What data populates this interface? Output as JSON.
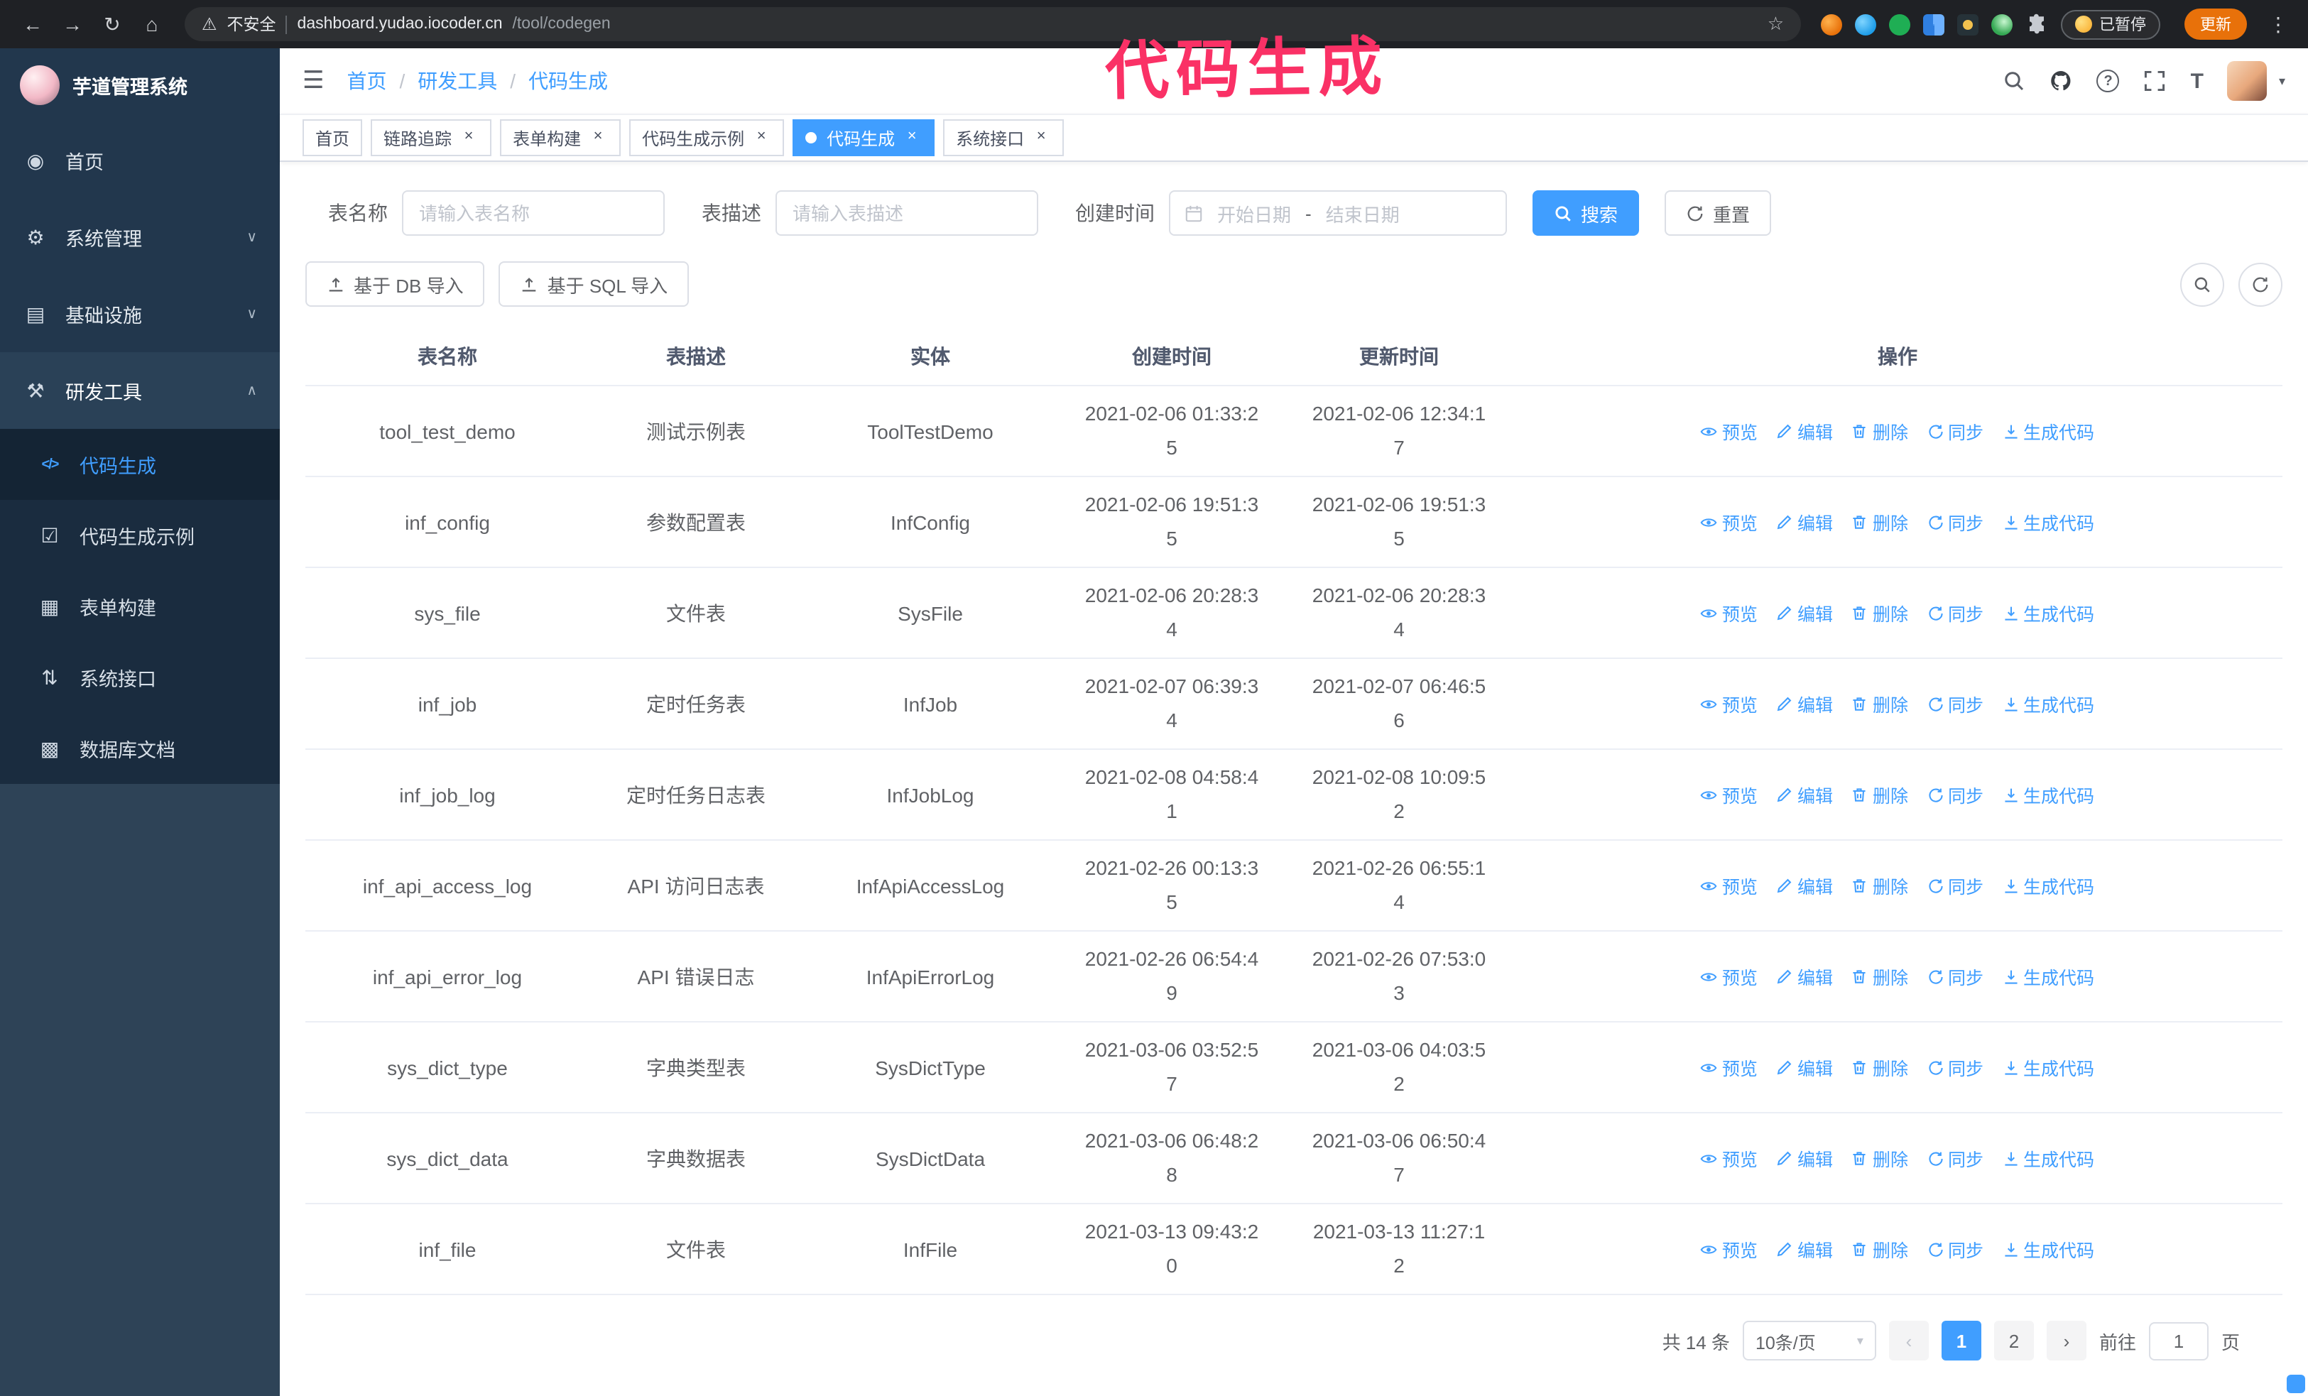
{
  "annotation": {
    "text": "代码生成"
  },
  "browser": {
    "security_warning": "不安全",
    "url_host": "dashboard.yudao.iocoder.cn",
    "url_path": "/tool/codegen",
    "paused_badge": "已暂停",
    "update_label": "更新"
  },
  "icons": {
    "back": "←",
    "forward": "→",
    "reload": "↻",
    "home": "⌂",
    "warning": "⚠",
    "star": "☆",
    "kebab": "⋮",
    "hamburger": "☰",
    "chevron_down": "∨",
    "chevron_up": "∧",
    "caret_down": "▾",
    "close": "×",
    "question": "?",
    "font_size": "T",
    "prev": "‹",
    "next": "›",
    "sidebar_home": "◉",
    "sidebar_system": "⚙",
    "sidebar_infra": "▤",
    "sidebar_tools": "⚒",
    "sub_codegen": "</>",
    "sub_example": "☑",
    "sub_form": "▦",
    "sub_api": "⇅",
    "sub_db": "▩"
  },
  "sidebar": {
    "logo_title": "芋道管理系统",
    "items": [
      {
        "label": "首页"
      },
      {
        "label": "系统管理"
      },
      {
        "label": "基础设施"
      },
      {
        "label": "研发工具"
      }
    ],
    "subitems": [
      {
        "label": "代码生成"
      },
      {
        "label": "代码生成示例"
      },
      {
        "label": "表单构建"
      },
      {
        "label": "系统接口"
      },
      {
        "label": "数据库文档"
      }
    ]
  },
  "navbar": {
    "breadcrumb": [
      "首页",
      "研发工具",
      "代码生成"
    ]
  },
  "tabs": [
    {
      "label": "首页"
    },
    {
      "label": "链路追踪"
    },
    {
      "label": "表单构建"
    },
    {
      "label": "代码生成示例"
    },
    {
      "label": "代码生成"
    },
    {
      "label": "系统接口"
    }
  ],
  "filters": {
    "name_label": "表名称",
    "name_placeholder": "请输入表名称",
    "desc_label": "表描述",
    "desc_placeholder": "请输入表描述",
    "time_label": "创建时间",
    "start_placeholder": "开始日期",
    "range_separator": "-",
    "end_placeholder": "结束日期",
    "search_label": "搜索",
    "reset_label": "重置"
  },
  "toolbar": {
    "import_db_label": "基于 DB 导入",
    "import_sql_label": "基于 SQL 导入"
  },
  "table": {
    "columns": [
      "表名称",
      "表描述",
      "实体",
      "创建时间",
      "更新时间",
      "操作"
    ],
    "ops": [
      {
        "name": "preview-link",
        "icon": "eye",
        "label": "预览"
      },
      {
        "name": "edit-link",
        "icon": "edit",
        "label": "编辑"
      },
      {
        "name": "delete-link",
        "icon": "delete",
        "label": "删除"
      },
      {
        "name": "sync-link",
        "icon": "sync",
        "label": "同步"
      },
      {
        "name": "generate-code-link",
        "icon": "download",
        "label": "生成代码"
      }
    ],
    "rows": [
      {
        "name": "tool_test_demo",
        "desc": "测试示例表",
        "entity": "ToolTestDemo",
        "created": "2021-02-06 01:33:25",
        "updated": "2021-02-06 12:34:17"
      },
      {
        "name": "inf_config",
        "desc": "参数配置表",
        "entity": "InfConfig",
        "created": "2021-02-06 19:51:35",
        "updated": "2021-02-06 19:51:35"
      },
      {
        "name": "sys_file",
        "desc": "文件表",
        "entity": "SysFile",
        "created": "2021-02-06 20:28:34",
        "updated": "2021-02-06 20:28:34"
      },
      {
        "name": "inf_job",
        "desc": "定时任务表",
        "entity": "InfJob",
        "created": "2021-02-07 06:39:34",
        "updated": "2021-02-07 06:46:56"
      },
      {
        "name": "inf_job_log",
        "desc": "定时任务日志表",
        "entity": "InfJobLog",
        "created": "2021-02-08 04:58:41",
        "updated": "2021-02-08 10:09:52"
      },
      {
        "name": "inf_api_access_log",
        "desc": "API 访问日志表",
        "entity": "InfApiAccessLog",
        "created": "2021-02-26 00:13:35",
        "updated": "2021-02-26 06:55:14"
      },
      {
        "name": "inf_api_error_log",
        "desc": "API 错误日志",
        "entity": "InfApiErrorLog",
        "created": "2021-02-26 06:54:49",
        "updated": "2021-02-26 07:53:03"
      },
      {
        "name": "sys_dict_type",
        "desc": "字典类型表",
        "entity": "SysDictType",
        "created": "2021-03-06 03:52:57",
        "updated": "2021-03-06 04:03:52"
      },
      {
        "name": "sys_dict_data",
        "desc": "字典数据表",
        "entity": "SysDictData",
        "created": "2021-03-06 06:48:28",
        "updated": "2021-03-06 06:50:47"
      },
      {
        "name": "inf_file",
        "desc": "文件表",
        "entity": "InfFile",
        "created": "2021-03-13 09:43:20",
        "updated": "2021-03-13 11:27:12"
      }
    ]
  },
  "pagination": {
    "total_text": "共 14 条",
    "page_size": "10条/页",
    "pages": [
      "1",
      "2"
    ],
    "goto_prefix": "前往",
    "goto_value": "1",
    "goto_suffix": "页"
  },
  "colors": {
    "primary": "#409eff",
    "annotation": "#fa3166"
  }
}
